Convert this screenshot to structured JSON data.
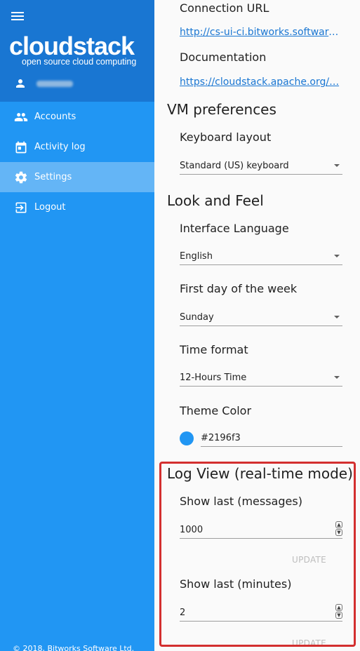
{
  "brand": {
    "logo_main": "cloudstack",
    "logo_sub": "open source cloud computing"
  },
  "sidebar": {
    "items": [
      {
        "label": "Accounts",
        "icon": "people-icon"
      },
      {
        "label": "Activity log",
        "icon": "calendar-icon"
      },
      {
        "label": "Settings",
        "icon": "gear-icon"
      },
      {
        "label": "Logout",
        "icon": "logout-icon"
      }
    ],
    "active": "Settings",
    "footer": "© 2018, Bitworks Software Ltd."
  },
  "settings": {
    "connection_url_label": "Connection URL",
    "connection_url": "http://cs-ui-ci.bitworks.software…",
    "documentation_label": "Documentation",
    "documentation_url": "https://cloudstack.apache.org/…",
    "vm_preferences_title": "VM preferences",
    "keyboard_layout_label": "Keyboard layout",
    "keyboard_layout_value": "Standard (US) keyboard",
    "look_feel_title": "Look and Feel",
    "interface_language_label": "Interface Language",
    "interface_language_value": "English",
    "first_day_label": "First day of the week",
    "first_day_value": "Sunday",
    "time_format_label": "Time format",
    "time_format_value": "12-Hours Time",
    "theme_color_label": "Theme Color",
    "theme_color_value": "#2196f3",
    "log_view_title": "Log View (real-time mode)",
    "show_last_messages_label": "Show last (messages)",
    "show_last_messages_value": "1000",
    "show_last_minutes_label": "Show last (minutes)",
    "show_last_minutes_value": "2",
    "update_label": "UPDATE"
  },
  "colors": {
    "sidebar_bg": "#2196f3",
    "sidebar_header": "#1976d2",
    "active_item": "#64b5f6",
    "link": "#1976d2",
    "highlight_border": "#d32f2f"
  }
}
